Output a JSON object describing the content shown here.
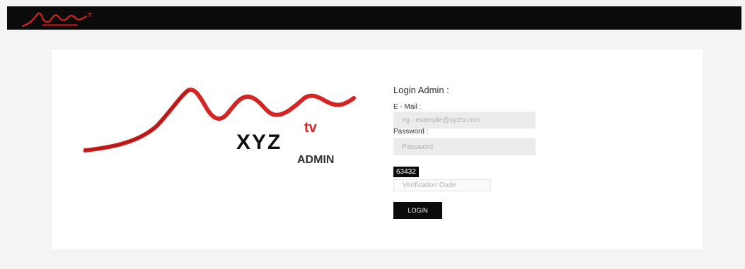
{
  "header": {
    "logo_icon": "xyz-tv-mountain-logo"
  },
  "branding": {
    "logo_main": "XYZ",
    "logo_superscript": "tv",
    "logo_sub": "ADMIN",
    "accent_color": "#d42424"
  },
  "login_form": {
    "title": "Login Admin :",
    "email_label": "E - Mail :",
    "email_placeholder": "eg : example@xyztv.com",
    "password_label": "Password :",
    "password_placeholder": "Password",
    "captcha_code": "63432",
    "verification_placeholder": "Verification Code",
    "login_button": "LOGIN"
  }
}
